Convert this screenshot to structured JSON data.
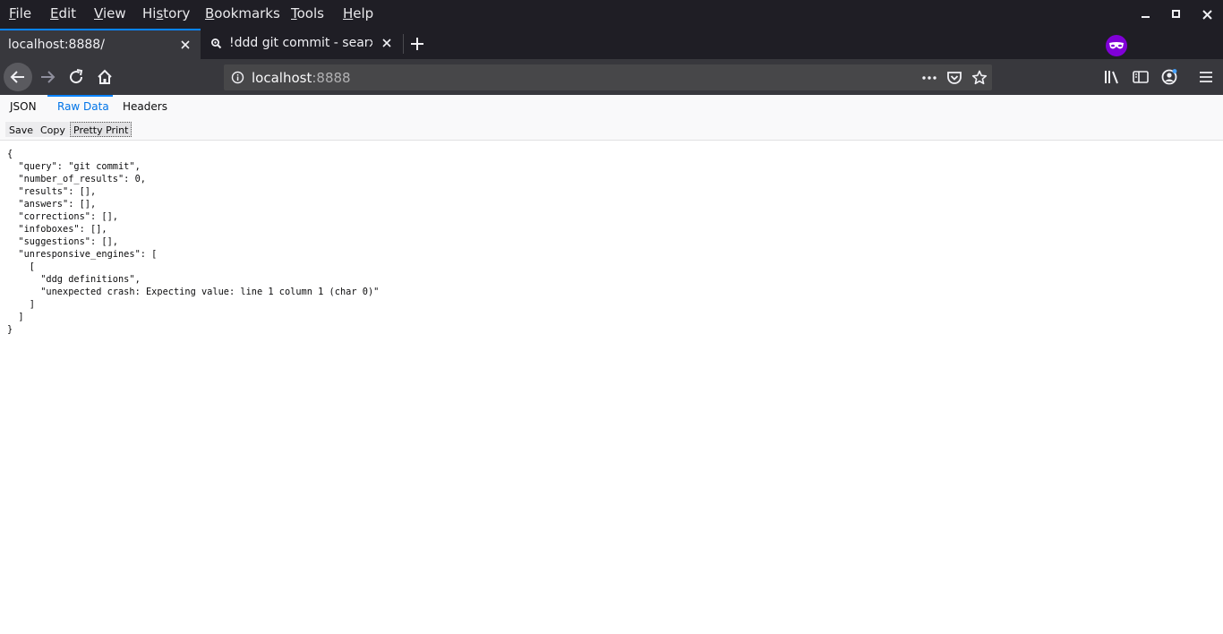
{
  "menubar": {
    "items": [
      {
        "label": "File",
        "accel": "F",
        "rest": "ile"
      },
      {
        "label": "Edit",
        "accel": "E",
        "rest": "dit"
      },
      {
        "label": "View",
        "accel": "V",
        "rest": "iew"
      },
      {
        "label": "History",
        "pre": "Hi",
        "accel": "s",
        "rest": "tory"
      },
      {
        "label": "Bookmarks",
        "accel": "B",
        "rest": "ookmarks"
      },
      {
        "label": "Tools",
        "accel": "T",
        "rest": "ools"
      },
      {
        "label": "Help",
        "accel": "H",
        "rest": "elp"
      }
    ]
  },
  "tabs": [
    {
      "title": "localhost:8888/",
      "active": true
    },
    {
      "title": "!ddd git commit - searx",
      "active": false
    }
  ],
  "urlbar": {
    "host": "localhost",
    "port": ":8888"
  },
  "viewer": {
    "tabs": [
      "JSON",
      "Raw Data",
      "Headers"
    ],
    "selected_tab": "Raw Data",
    "buttons": [
      "Save",
      "Copy",
      "Pretty Print"
    ]
  },
  "raw_json": "{\n  \"query\": \"git commit\",\n  \"number_of_results\": 0,\n  \"results\": [],\n  \"answers\": [],\n  \"corrections\": [],\n  \"infoboxes\": [],\n  \"suggestions\": [],\n  \"unresponsive_engines\": [\n    [\n      \"ddg definitions\",\n      \"unexpected crash: Expecting value: line 1 column 1 (char 0)\"\n    ]\n  ]\n}",
  "colors": {
    "accent": "#0a84ff",
    "private": "#8000d7",
    "chrome_dark": "#1f1e25",
    "toolbar": "#38383d"
  }
}
